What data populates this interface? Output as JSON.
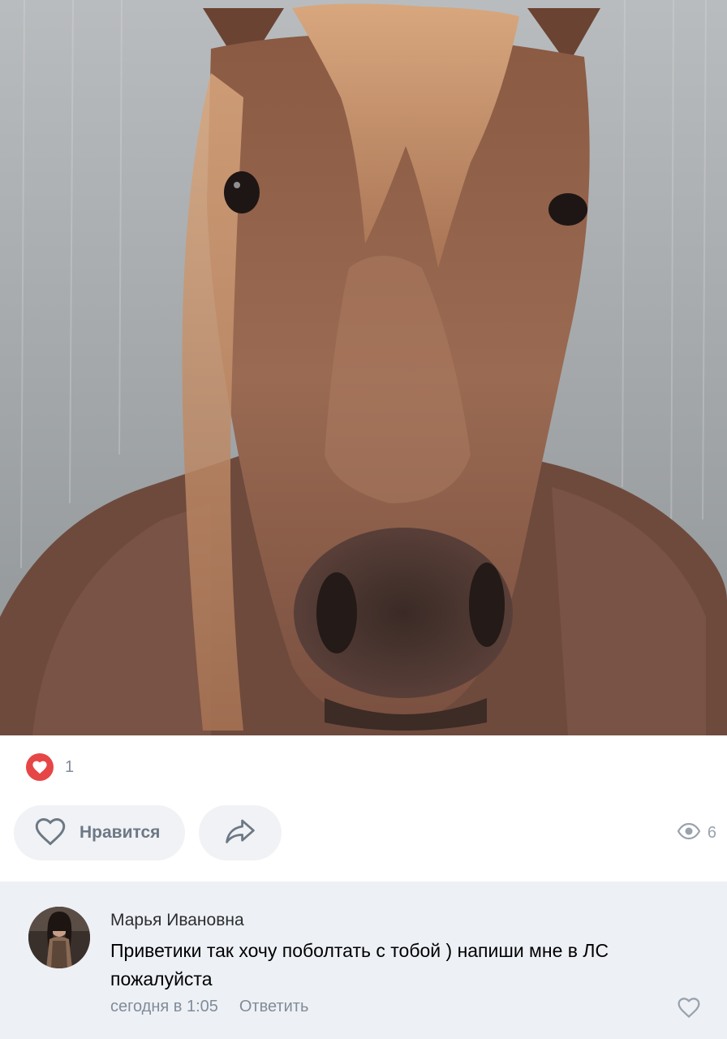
{
  "post": {
    "photo_alt": "",
    "reaction_icon": "heart-filled-icon",
    "reaction_count": "1",
    "like_label": "Нравится",
    "share_icon": "share-arrow-icon",
    "views_icon": "eye-icon",
    "views_count": "6"
  },
  "comment": {
    "author": "Марья Ивановна",
    "text": "Приветики так хочу поболтать с тобой ) напиши мне в ЛС пожалуйста",
    "time": "сегодня в 1:05",
    "reply_label": "Ответить",
    "like_icon": "heart-outline-icon"
  },
  "colors": {
    "reaction_red": "#e64646",
    "button_bg": "#f0f2f5",
    "comment_bg": "#edf0f5",
    "secondary_text": "#818c99"
  }
}
